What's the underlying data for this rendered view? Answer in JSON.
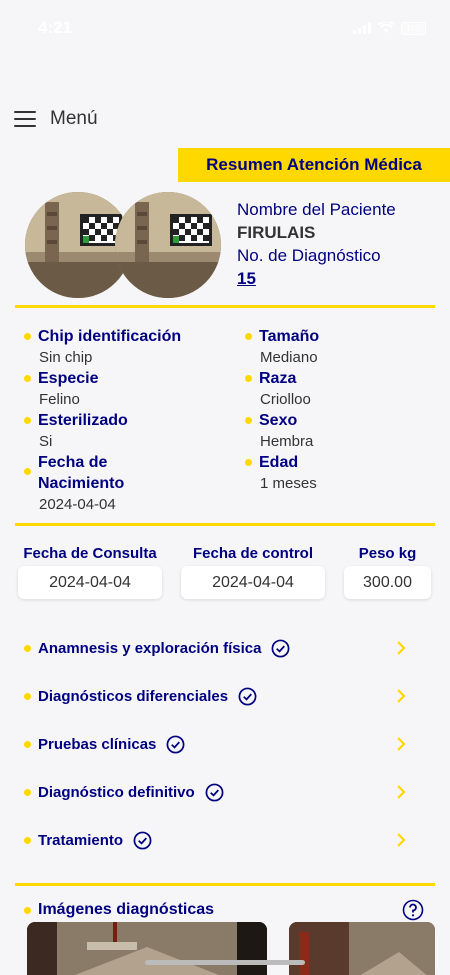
{
  "status": {
    "time": "4:21",
    "battery": "100"
  },
  "menu": {
    "label": "Menú"
  },
  "header": {
    "title": "Resumen Atención Médica"
  },
  "patient": {
    "name_label": "Nombre del Paciente",
    "name": "FIRULAIS",
    "diag_label": "No. de Diagnóstico",
    "diag_number": "15"
  },
  "details": {
    "left": [
      {
        "label": "Chip identificación",
        "value": "Sin chip"
      },
      {
        "label": "Especie",
        "value": "Felino"
      },
      {
        "label": "Esterilizado",
        "value": "Si"
      },
      {
        "label": "Fecha de Nacimiento",
        "value": "2024-04-04"
      }
    ],
    "right": [
      {
        "label": "Tamaño",
        "value": "Mediano"
      },
      {
        "label": "Raza",
        "value": "Criolloo"
      },
      {
        "label": "Sexo",
        "value": "Hembra"
      },
      {
        "label": "Edad",
        "value": "1 meses"
      }
    ]
  },
  "dates": {
    "consulta": {
      "label": "Fecha de Consulta",
      "value": "2024-04-04"
    },
    "control": {
      "label": "Fecha de control",
      "value": "2024-04-04"
    },
    "peso": {
      "label": "Peso kg",
      "value": "300.00"
    }
  },
  "sections": [
    {
      "label": "Anamnesis y exploración física"
    },
    {
      "label": "Diagnósticos diferenciales"
    },
    {
      "label": "Pruebas clínicas"
    },
    {
      "label": "Diagnóstico definitivo"
    },
    {
      "label": "Tratamiento"
    }
  ],
  "images": {
    "label": "Imágenes diagnósticas"
  },
  "colors": {
    "accent": "#ffd800",
    "primary": "#000080",
    "background": "#f6f6f8"
  }
}
